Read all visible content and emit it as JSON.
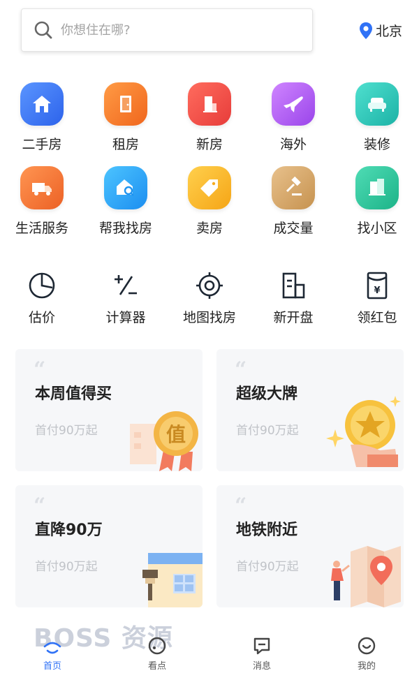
{
  "search": {
    "placeholder": "你想住在哪?"
  },
  "city": {
    "name": "北京"
  },
  "categories_row1": [
    {
      "label": "二手房",
      "icon": "house-icon",
      "color": "#3f7cf6"
    },
    {
      "label": "租房",
      "icon": "door-icon",
      "color": "#f5802f"
    },
    {
      "label": "新房",
      "icon": "building-icon",
      "color": "#f2504a"
    },
    {
      "label": "海外",
      "icon": "plane-icon",
      "color": "#b45ff0"
    },
    {
      "label": "装修",
      "icon": "sofa-icon",
      "color": "#2fc6b9"
    }
  ],
  "categories_row2": [
    {
      "label": "生活服务",
      "icon": "truck-icon",
      "color": "#f37a3a"
    },
    {
      "label": "帮我找房",
      "icon": "search-house-icon",
      "color": "#2fa8f2"
    },
    {
      "label": "卖房",
      "icon": "tag-icon",
      "color": "#fbb62d"
    },
    {
      "label": "成交量",
      "icon": "hammer-icon",
      "color": "#d9a868"
    },
    {
      "label": "找小区",
      "icon": "community-icon",
      "color": "#2fc39a"
    }
  ],
  "tools": [
    {
      "label": "估价",
      "icon": "pie-chart-icon"
    },
    {
      "label": "计算器",
      "icon": "calculator-icon"
    },
    {
      "label": "地图找房",
      "icon": "target-icon"
    },
    {
      "label": "新开盘",
      "icon": "building-outline-icon"
    },
    {
      "label": "领红包",
      "icon": "red-envelope-icon"
    }
  ],
  "cards": [
    {
      "title": "本周值得买",
      "subtitle": "首付90万起",
      "art": "value-medal-icon",
      "art_text": "值"
    },
    {
      "title": "超级大牌",
      "subtitle": "首付90万起",
      "art": "star-coin-icon"
    },
    {
      "title": "直降90万",
      "subtitle": "首付90万起",
      "art": "paint-house-icon"
    },
    {
      "title": "地铁附近",
      "subtitle": "首付90万起",
      "art": "map-pin-icon"
    }
  ],
  "tabbar": [
    {
      "label": "首页",
      "icon": "home-tab-icon",
      "active": true
    },
    {
      "label": "看点",
      "icon": "discover-icon",
      "active": false
    },
    {
      "label": "消息",
      "icon": "message-icon",
      "active": false
    },
    {
      "label": "我的",
      "icon": "profile-icon",
      "active": false
    }
  ],
  "watermark": "BOSS 资源",
  "colors": {
    "accent": "#3072f6",
    "text": "#222222",
    "muted": "#c0c3c8"
  }
}
